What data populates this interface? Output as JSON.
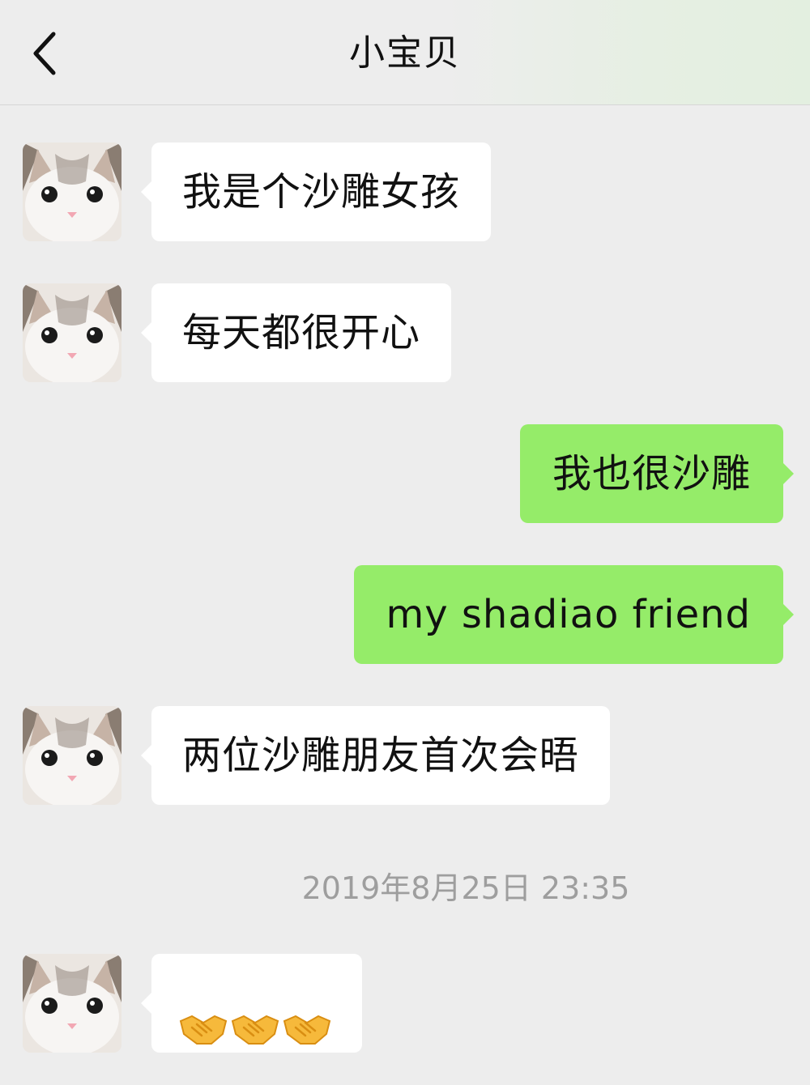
{
  "header": {
    "title": "小宝贝",
    "back_icon": "chevron-left-icon"
  },
  "messages": [
    {
      "side": "left",
      "text": "我是个沙雕女孩",
      "avatar": "cat-avatar"
    },
    {
      "side": "left",
      "text": "每天都很开心",
      "avatar": "cat-avatar"
    },
    {
      "side": "right",
      "text": "我也很沙雕"
    },
    {
      "side": "right",
      "text": "my shadiao friend"
    },
    {
      "side": "left",
      "text": "两位沙雕朋友首次会晤",
      "avatar": "cat-avatar"
    },
    {
      "side": "left",
      "text": "🤝🤝🤝",
      "avatar": "cat-avatar",
      "emoji": "handshake-icon",
      "count": 3
    }
  ],
  "timestamp": "2019年8月25日 23:35",
  "colors": {
    "background": "#ededed",
    "incoming_bubble": "#ffffff",
    "outgoing_bubble": "#95ec69",
    "timestamp_text": "#9e9e9e"
  }
}
